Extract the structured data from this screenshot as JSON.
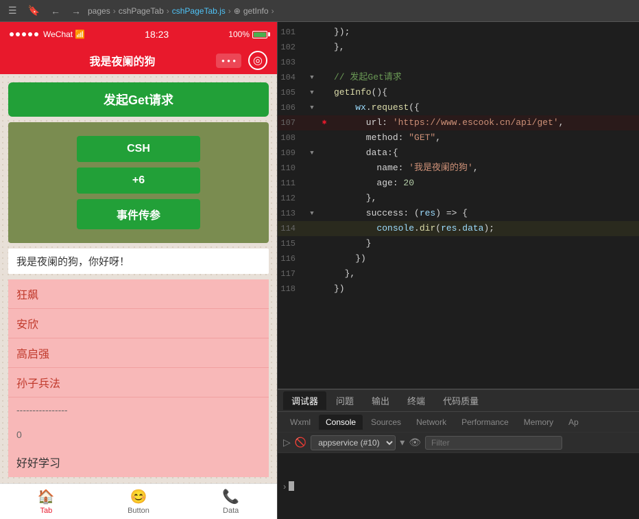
{
  "topbar": {
    "breadcrumb": [
      "pages",
      "cshPageTab",
      "cshPageTab.js",
      "getInfo"
    ]
  },
  "wechat": {
    "status": {
      "dots": 5,
      "carrier": "WeChat",
      "wifi": true,
      "time": "18:23",
      "battery": "100%"
    },
    "nav": {
      "title": "我是夜阑的狗"
    },
    "buttons": {
      "get_request": "发起Get请求",
      "csh": "CSH",
      "plus6": "+6",
      "event": "事件传参"
    },
    "text_display": "我是夜阑的狗，你好呀！",
    "list_items": [
      {
        "text": "狂飙",
        "type": "red"
      },
      {
        "text": "安欣",
        "type": "red"
      },
      {
        "text": "高启强",
        "type": "red"
      },
      {
        "text": "孙子兵法",
        "type": "red"
      },
      {
        "text": "----------------",
        "type": "separator"
      },
      {
        "text": "0",
        "type": "zero"
      },
      {
        "text": "好好学习",
        "type": "normal"
      }
    ],
    "tabs": [
      {
        "label": "Tab",
        "icon": "🏠",
        "active": true
      },
      {
        "label": "Button",
        "icon": "😊",
        "active": false
      },
      {
        "label": "Data",
        "icon": "📞",
        "active": false
      }
    ]
  },
  "code_editor": {
    "lines": [
      {
        "num": "101",
        "content": "});"
      },
      {
        "num": "102",
        "content": "},"
      },
      {
        "num": "103",
        "content": ""
      },
      {
        "num": "104",
        "comment": "// 发起Get请求"
      },
      {
        "num": "105",
        "content": "getInfo(){"
      },
      {
        "num": "106",
        "content": "  wx.request({"
      },
      {
        "num": "107",
        "content": "    url: 'https://www.escook.cn/api/get',",
        "error": true
      },
      {
        "num": "108",
        "content": "    method: \"GET\","
      },
      {
        "num": "109",
        "content": "    data:{"
      },
      {
        "num": "110",
        "content": "      name: '我是夜阑的狗',"
      },
      {
        "num": "111",
        "content": "      age: 20"
      },
      {
        "num": "112",
        "content": "    },"
      },
      {
        "num": "113",
        "content": "    success: (res) => {"
      },
      {
        "num": "114",
        "content": "      console.dir(res.data);",
        "highlighted": true
      },
      {
        "num": "115",
        "content": "    }"
      },
      {
        "num": "116",
        "content": "  })"
      },
      {
        "num": "117",
        "content": "},"
      },
      {
        "num": "118",
        "content": "})"
      }
    ]
  },
  "bottom_panel": {
    "tabs": [
      "调试器",
      "问题",
      "输出",
      "终端",
      "代码质量"
    ],
    "devtools_tabs": [
      "Wxml",
      "Console",
      "Sources",
      "Network",
      "Performance",
      "Memory",
      "Ap"
    ],
    "active_tab": "调试器",
    "active_devtool": "Console",
    "service": "appservice (#10)",
    "filter_placeholder": "Filter"
  }
}
